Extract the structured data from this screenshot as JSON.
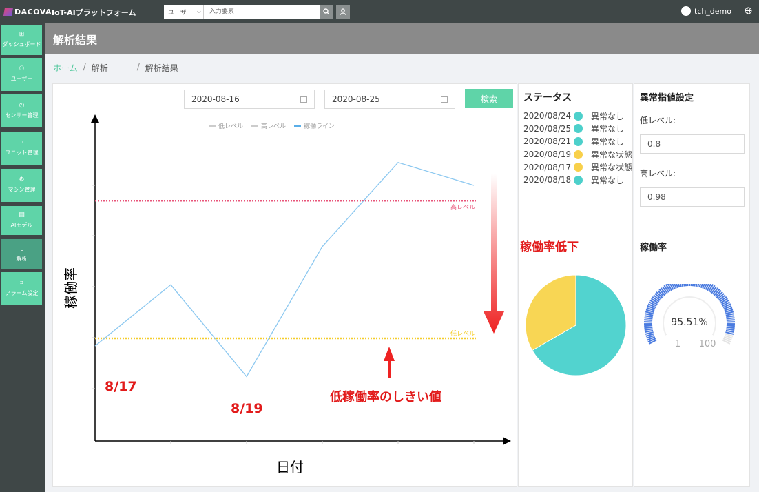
{
  "topbar": {
    "logo_text": "DACOVA",
    "app_name": "IoT-AIプラットフォーム",
    "search_select": "ユーザー",
    "search_placeholder": "入力要素",
    "user_name": "tch_demo"
  },
  "sidebar": {
    "items": [
      {
        "label": "ダッシュボード",
        "icon": "dashboard-icon"
      },
      {
        "label": "ユーザー",
        "icon": "user-icon"
      },
      {
        "label": "センサー管理",
        "icon": "sensor-icon"
      },
      {
        "label": "ユニット管理",
        "icon": "unit-icon"
      },
      {
        "label": "マシン管理",
        "icon": "machine-icon"
      },
      {
        "label": "AIモデル",
        "icon": "ai-model-icon"
      },
      {
        "label": "解析",
        "icon": "chart-icon"
      },
      {
        "label": "アラーム設定",
        "icon": "alarm-icon"
      }
    ],
    "active": "解析"
  },
  "header": {
    "title": "解析結果"
  },
  "breadcrumb": {
    "home": "ホーム",
    "middle": "解析",
    "current": "解析結果"
  },
  "filter": {
    "start_date": "2020-08-16",
    "end_date": "2020-08-25",
    "search_label": "検索"
  },
  "legend": {
    "low": "低レベル",
    "high": "高レベル",
    "line": "稼働ライン"
  },
  "chart_annotations": {
    "low_line_label": "低レベル",
    "high_line_label": "高レベル",
    "y_axis_label": "稼働率",
    "x_axis_label": "日付",
    "callout_817": "8/17",
    "callout_819": "8/19",
    "threshold_callout": "低稼働率のしきい値",
    "decline_callout": "稼働率低下"
  },
  "chart_data": {
    "type": "line",
    "series": [
      {
        "name": "稼働ライン",
        "values": [
          0.79,
          0.87,
          0.75,
          0.92,
          1.03,
          1.0
        ]
      }
    ],
    "thresholds": {
      "low": 0.8,
      "high": 0.98
    },
    "ylabel": "稼働率",
    "xlabel": "日付",
    "grid": false,
    "colors": {
      "line": "#8cc8f0",
      "high": "#e8557a",
      "low": "#f5cd2a"
    }
  },
  "status": {
    "title": "ステータス",
    "rows": [
      {
        "date": "2020/08/24",
        "color": "#4dd0cb",
        "text": "異常なし"
      },
      {
        "date": "2020/08/25",
        "color": "#4dd0cb",
        "text": "異常なし"
      },
      {
        "date": "2020/08/21",
        "color": "#4dd0cb",
        "text": "異常なし"
      },
      {
        "date": "2020/08/19",
        "color": "#f8d04a",
        "text": "異常な状態"
      },
      {
        "date": "2020/08/17",
        "color": "#f8d04a",
        "text": "異常な状態"
      },
      {
        "date": "2020/08/18",
        "color": "#4dd0cb",
        "text": "異常なし"
      }
    ],
    "pie": {
      "slices": [
        {
          "value": 4,
          "color": "#52d3cf"
        },
        {
          "value": 2,
          "color": "#f8d654"
        }
      ]
    }
  },
  "settings": {
    "title": "異常指値設定",
    "low_label": "低レベル:",
    "low_value": "0.8",
    "high_label": "高レベル:",
    "high_value": "0.98",
    "gauge_title": "稼働率",
    "gauge_value": "95.51%",
    "gauge_value_num": 95.51,
    "gauge_min": "1",
    "gauge_max": "100",
    "gauge_color": "#4a7be0"
  }
}
